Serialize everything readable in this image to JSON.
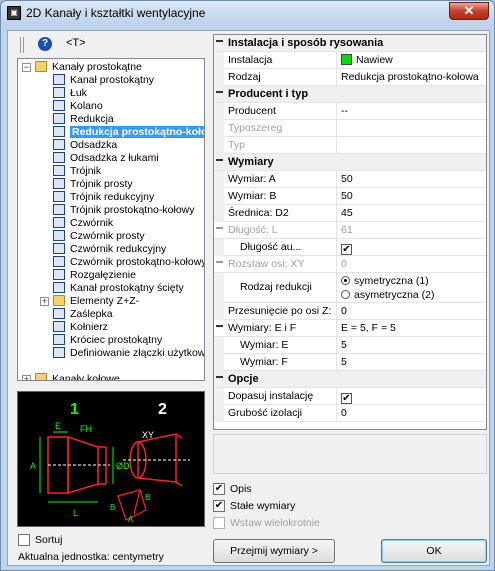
{
  "window": {
    "title": "2D Kanały i kształtki wentylacyjne",
    "close_label": "✕"
  },
  "toolbar": {
    "help_label": "?",
    "text_label": "<T>"
  },
  "tree": {
    "root_open": {
      "label": "Kanały prostokątne",
      "expander": "−"
    },
    "items": [
      {
        "label": "Kanał prostokątny",
        "icon": "duct-straight-icon"
      },
      {
        "label": "Łuk",
        "icon": "duct-bend-icon"
      },
      {
        "label": "Kolano",
        "icon": "duct-elbow-icon"
      },
      {
        "label": "Redukcja",
        "icon": "duct-reducer-icon"
      },
      {
        "label": "Redukcja prostokątno-kołowa",
        "icon": "duct-rect-round-reducer-icon"
      },
      {
        "label": "Odsadzka",
        "icon": "duct-offset-icon"
      },
      {
        "label": "Odsadzka z łukami",
        "icon": "duct-offset-bends-icon"
      },
      {
        "label": "Trójnik",
        "icon": "duct-tee-icon"
      },
      {
        "label": "Trójnik prosty",
        "icon": "duct-tee-straight-icon"
      },
      {
        "label": "Trójnik redukcyjny",
        "icon": "duct-tee-reducing-icon"
      },
      {
        "label": "Trójnik prostokątno-kołowy",
        "icon": "duct-tee-rect-round-icon"
      },
      {
        "label": "Czwórnik",
        "icon": "duct-cross-icon"
      },
      {
        "label": "Czwórnik prosty",
        "icon": "duct-cross-straight-icon"
      },
      {
        "label": "Czwórnik redukcyjny",
        "icon": "duct-cross-reducing-icon"
      },
      {
        "label": "Czwórnik prostokątno-kołowy",
        "icon": "duct-cross-rect-round-icon"
      },
      {
        "label": "Rozgałęzienie",
        "icon": "duct-branch-icon"
      },
      {
        "label": "Kanał prostokątny ścięty",
        "icon": "duct-cut-icon"
      }
    ],
    "sub_folder": {
      "label": "Elementy Z+Z-",
      "expander": "+"
    },
    "items2": [
      {
        "label": "Zaślepka",
        "icon": "duct-cap-icon"
      },
      {
        "label": "Kołnierz",
        "icon": "duct-flange-icon"
      },
      {
        "label": "Króciec prostokątny",
        "icon": "duct-spigot-icon"
      },
      {
        "label": "Definiowanie złączki użytkownika",
        "icon": "user-fitting-icon"
      }
    ],
    "root_closed": {
      "label": "Kanały kołowe",
      "expander": "+"
    }
  },
  "preview": {
    "label1": "1",
    "label2": "2",
    "dims": [
      "A",
      "E",
      "FH",
      "ØD",
      "L",
      "XY",
      "B",
      "A",
      "B"
    ]
  },
  "properties": {
    "cat1": {
      "label": "Instalacja i sposób rysowania"
    },
    "instalacja": {
      "key": "Instalacja",
      "value": "Nawiew",
      "color": "#00e000"
    },
    "rodzaj": {
      "key": "Rodzaj",
      "value": "Redukcja prostokątno-kołowa"
    },
    "cat2": {
      "label": "Producent i typ"
    },
    "producent": {
      "key": "Producent",
      "value": "--"
    },
    "typoszereg": {
      "key": "Typoszereg",
      "value": ""
    },
    "typ": {
      "key": "Typ",
      "value": ""
    },
    "cat3": {
      "label": "Wymiary"
    },
    "wym_a": {
      "key": "Wymiar: A",
      "value": "50"
    },
    "wym_b": {
      "key": "Wymiar: B",
      "value": "50"
    },
    "srednica": {
      "key": "Średnica: D2",
      "value": "45"
    },
    "dlugosc": {
      "key": "Długość: L",
      "value": "61"
    },
    "dlugosc_auto": {
      "key": "Długość au...",
      "value": "✔"
    },
    "rozstaw": {
      "key": "Rozstaw osi: XY",
      "value": "0"
    },
    "rodzaj_redukcji": {
      "key": "Rodzaj redukcji",
      "opt1": "symetryczna (1)",
      "opt2": "asymetryczna (2)"
    },
    "przesuniecie": {
      "key": "Przesunięcie po osi Z:",
      "value": "0"
    },
    "wym_eif": {
      "key": "Wymiary: E i F",
      "value": "E = 5,  F = 5"
    },
    "wym_e": {
      "key": "Wymiar: E",
      "value": "5"
    },
    "wym_f": {
      "key": "Wymiar: F",
      "value": "5"
    },
    "cat4": {
      "label": "Opcje"
    },
    "dopasuj": {
      "key": "Dopasuj instalację",
      "value": "✔"
    },
    "grubosc": {
      "key": "Grubość izolacji",
      "value": "0"
    }
  },
  "options": {
    "opis": {
      "label": "Opis",
      "checked": "✔"
    },
    "stale": {
      "label": "Stałe wymiary",
      "checked": "✔"
    },
    "wstaw": {
      "label": "Wstaw wielokrotnie",
      "checked": ""
    }
  },
  "bottom": {
    "sortuj": "Sortuj",
    "units": "Aktualna jednostka: centymetry",
    "przejmij": "Przejmij wymiary >",
    "ok": "OK"
  }
}
